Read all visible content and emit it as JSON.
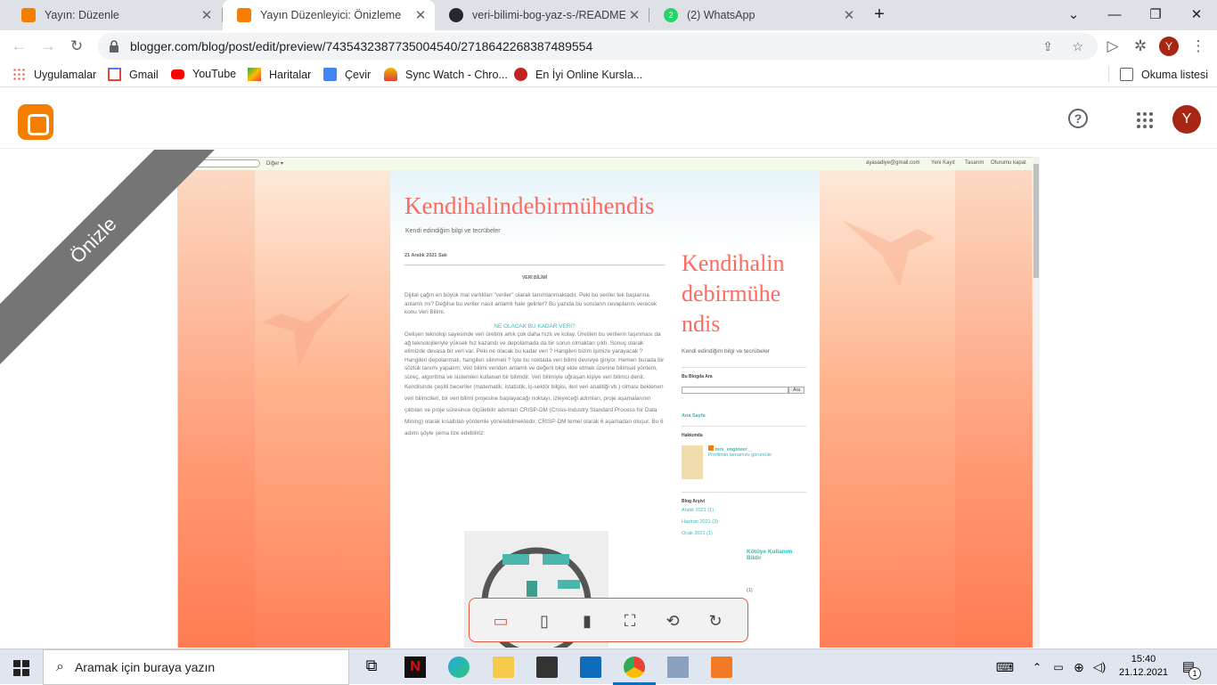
{
  "browser": {
    "tabs": [
      {
        "title": "Yayın: Düzenle",
        "icon": "blogger-icon",
        "active": false
      },
      {
        "title": "Yayın Düzenleyici: Önizleme",
        "icon": "blogger-icon",
        "active": true
      },
      {
        "title": "veri-bilimi-bog-yaz-s-/README.m",
        "icon": "github-icon",
        "active": false
      },
      {
        "title": "(2) WhatsApp",
        "icon": "whatsapp-icon",
        "active": false
      }
    ],
    "new_tab": "+",
    "url": "blogger.com/blog/post/edit/preview/7435432387735004540/2718642268387489554",
    "avatar_letter": "Y",
    "bookmarks": [
      "Uygulamalar",
      "Gmail",
      "YouTube",
      "Haritalar",
      "Çevir",
      "Sync Watch - Chro...",
      "En İyi Online Kursla..."
    ],
    "reading_list": "Okuma listesi"
  },
  "blogger": {
    "avatar_letter": "Y",
    "help": "?",
    "ribbon": "Önizle"
  },
  "blog": {
    "nav_search_btn": "Diğer ▾",
    "nav_email": "ayasadiye@gmail.com",
    "nav_links": [
      "Yeni Kayıt",
      "Tasarım",
      "Oturumu kapat"
    ],
    "title": "Kendihalindebirmühendis",
    "description": "Kendi edindiğim bilgi ve tecrübeler",
    "post_date": "21 Aralık 2021 Salı",
    "heading1": "VERİ BİLİMİ",
    "p1": "Dijital çağın en büyük mal varlıkları \"veriler\" olarak tanımlanmaktadır. Peki bu veriler tek başlarına anlamlı mı? Değilse bu veriler nasıl anlamlı hale gelirler? Bu yazıda bu soruların cevaplarını verecek konu Veri Bilimi.",
    "heading2": "NE OLACAK BU KADAR VERİ?",
    "p2": "Gelişen teknoloji sayesinde veri üretimi artık çok daha hızlı ve kolay. Üretilen bu verilerin taşınması da ağ teknolojileriyle yüksek hız kazandı ve depolamada da bir sorun olmaktan çıktı. Sonuç olarak elimizde devasa bir veri var. Peki ne olacak bu kadar veri ? Hangileri bizim işimize yarayacak ? Hangileri depolanmalı, hangileri silinmeli ? İşte bu noktada veri bilimi devreye giriyor. Hemen burada bir sözlük tanımı yapalım: Veri bilimi veriden anlamlı ve değerli bilgi elde etmek üzerine bilimsel yöntem, süreç, algoritma ve sistemleri kullanan bir bilimdir. Veri bilimiyle uğraşan kişiye veri bilimci denir.",
    "p3": "Kendisinde çeşitli beceriler (matematik, istatistik, iş-sektör bilgisi, ileri veri analitiği vb.) olması beklenen veri bilimcileri, bir veri bilimi projesine başlayacağı noktayı, izleyeceği adımları, proje aşamalarının çıktıları ve proje süresince ölçülebilir adımları CRISP-DM (Cross-Industry Standard Process for Data Mining) olarak kısaltılan yöntemle yönetebilmektedir. CRISP-DM temel olarak 6 aşamadan oluşur. Bu 6 adımı şöyle şema ilze edebiliriz:",
    "sidebar": {
      "title": "Kendihalin debirmühe ndis",
      "description": "Kendi edindiğim bilgi ve tecrübeler",
      "search_heading": "Bu Blogda Ara",
      "search_button": "Ara",
      "home_link": "Ana Sayfa",
      "about_heading": "Hakkımda",
      "profile_name": "mrs_engineer__",
      "profile_link": "Profilimin tamamını görüntüle",
      "archive_heading": "Blog Arşivi",
      "archive": [
        "Aralık 2021 (1)",
        "Haziran 2021 (3)",
        "Ocak 2021 (1)"
      ],
      "report": "Kötüye Kullanım Bildir",
      "trailing_count": "(1)"
    }
  },
  "taskbar": {
    "search_placeholder": "Aramak için buraya yazın",
    "time": "15:40",
    "date": "21.12.2021",
    "notification_count": "1"
  },
  "colors": {
    "accent": "#f57d00",
    "blog_title": "#ff6a60",
    "devbar_border": "#e35b3f",
    "ribbon": "#757575"
  }
}
